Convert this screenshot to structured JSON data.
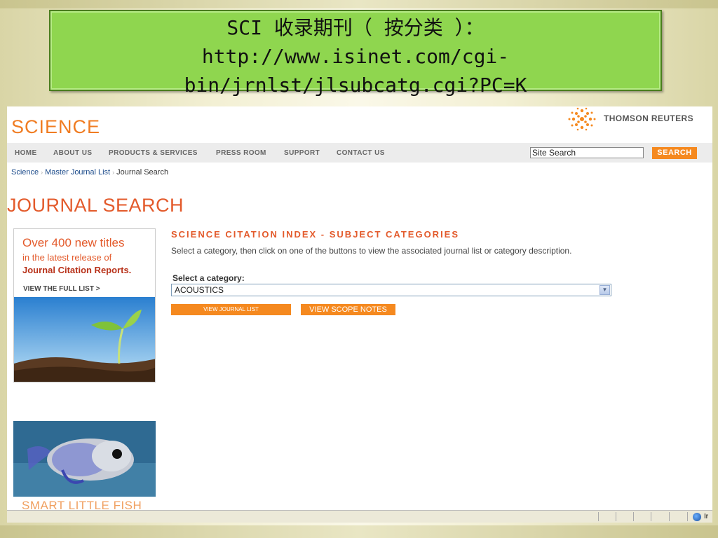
{
  "slide": {
    "title_line1": "SCI 收录期刊（ 按分类 ）：",
    "title_line2": "http://www.isinet.com/cgi-",
    "title_line3": "bin/jrnlst/jlsubcatg.cgi?PC=K"
  },
  "site": {
    "logo": "SCIENCE",
    "brand": "THOMSON REUTERS"
  },
  "nav": {
    "items": [
      "HOME",
      "ABOUT US",
      "PRODUCTS & SERVICES",
      "PRESS ROOM",
      "SUPPORT",
      "CONTACT US"
    ],
    "search_placeholder": "Site Search",
    "search_button": "SEARCH"
  },
  "breadcrumb": [
    "Science",
    "Master Journal List",
    "Journal Search"
  ],
  "page": {
    "title": "JOURNAL SEARCH",
    "heading": "SCIENCE CITATION INDEX - SUBJECT CATEGORIES",
    "instructions": "Select a category, then click on one of the buttons to view the associated journal list or category description.",
    "select_label": "Select a category:",
    "selected_category": "ACOUSTICS",
    "btn_journal_list": "VIEW JOURNAL LIST",
    "btn_scope_notes": "VIEW SCOPE NOTES"
  },
  "ad": {
    "line1": "Over 400 new titles",
    "line2": "in the latest release of",
    "line3": "Journal Citation Reports.",
    "link": "VIEW THE FULL LIST >",
    "fish_caption": "SMART LITTLE FISH"
  },
  "statusbar": {
    "zone": "Ir"
  },
  "colors": {
    "accent": "#f5891f",
    "title": "#e35a2b",
    "banner": "#8fd64f"
  }
}
